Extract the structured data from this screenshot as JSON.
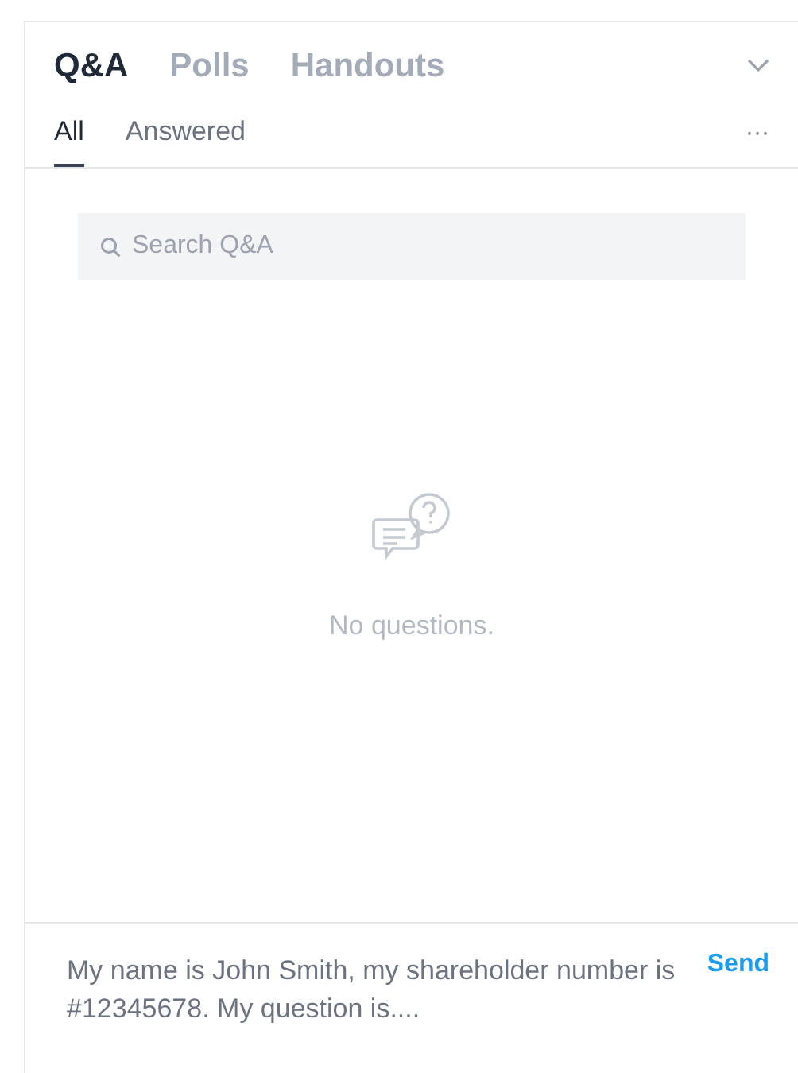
{
  "tabs": [
    {
      "label": "Q&A",
      "selected": true
    },
    {
      "label": "Polls",
      "selected": false
    },
    {
      "label": "Handouts",
      "selected": false
    }
  ],
  "filters": [
    {
      "label": "All",
      "selected": true
    },
    {
      "label": "Answered",
      "selected": false
    }
  ],
  "more": "···",
  "search": {
    "placeholder": "Search Q&A"
  },
  "empty_state": "No questions.",
  "composer": {
    "value": "My name is John Smith, my shareholder number is #12345678. My question is....",
    "send": "Send"
  }
}
